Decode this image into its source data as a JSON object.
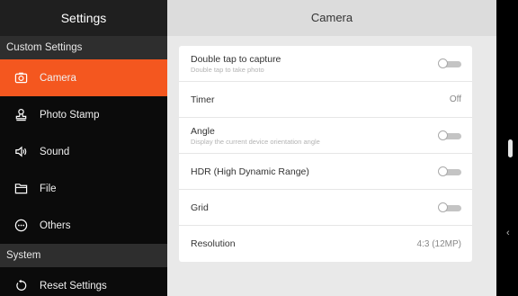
{
  "sidebar": {
    "title": "Settings",
    "sections": [
      {
        "label": "Custom Settings",
        "items": [
          {
            "label": "Camera",
            "icon": "camera-icon",
            "active": true
          },
          {
            "label": "Photo Stamp",
            "icon": "stamp-icon",
            "active": false
          },
          {
            "label": "Sound",
            "icon": "speaker-icon",
            "active": false
          },
          {
            "label": "File",
            "icon": "folder-icon",
            "active": false
          },
          {
            "label": "Others",
            "icon": "more-icon",
            "active": false
          }
        ]
      },
      {
        "label": "System",
        "items": [
          {
            "label": "Reset Settings",
            "icon": "reset-icon",
            "active": false
          }
        ]
      }
    ]
  },
  "main": {
    "title": "Camera",
    "settings": [
      {
        "title": "Double tap to capture",
        "subtitle": "Double tap to take photo",
        "type": "toggle",
        "on": false
      },
      {
        "title": "Timer",
        "value": "Off",
        "type": "value"
      },
      {
        "title": "Angle",
        "subtitle": "Display the current device orientation angle",
        "type": "toggle",
        "on": false
      },
      {
        "title": "HDR (High Dynamic Range)",
        "type": "toggle",
        "on": false
      },
      {
        "title": "Grid",
        "type": "toggle",
        "on": false
      },
      {
        "title": "Resolution",
        "value": "4:3 (12MP)",
        "type": "value"
      }
    ]
  },
  "edge": {
    "handle_icon": "drag-handle-icon",
    "chevron_icon": "chevron-left-icon",
    "chevron_glyph": "‹"
  },
  "colors": {
    "accent": "#f4571f",
    "sidebar_bg": "#0b0b0b",
    "main_bg": "#e9e9e9"
  }
}
